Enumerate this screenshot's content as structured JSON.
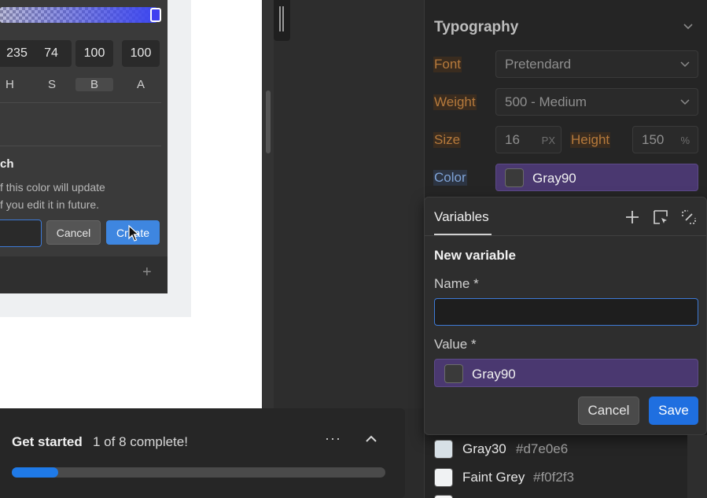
{
  "color_picker": {
    "values": [
      "235",
      "74",
      "100",
      "100"
    ],
    "labels": [
      "H",
      "S",
      "B",
      "A"
    ],
    "swatch_title": "ch",
    "swatch_desc_1": "f this color will update",
    "swatch_desc_2": "f you edit it in future.",
    "cancel_label": "Cancel",
    "create_label": "Create",
    "add_symbol": "+"
  },
  "get_started": {
    "title": "Get started",
    "count": "1 of 8 complete!",
    "more": "···",
    "progress": 0.125
  },
  "typography": {
    "title": "Typography",
    "font_label": "Font",
    "font_value": "Pretendard",
    "weight_label": "Weight",
    "weight_value": "500 - Medium",
    "size_label": "Size",
    "size_value": "16",
    "size_unit": "PX",
    "height_label": "Height",
    "height_value": "150",
    "height_unit": "%",
    "color_label": "Color",
    "color_value": "Gray90"
  },
  "variables": {
    "tab_label": "Variables",
    "new_title": "New variable",
    "name_label": "Name *",
    "name_value": "",
    "value_label": "Value *",
    "value_color": "Gray90",
    "cancel_label": "Cancel",
    "save_label": "Save"
  },
  "swatches": [
    {
      "name": "Gray30",
      "hex": "#d7e0e6"
    },
    {
      "name": "Faint Grey",
      "hex": "#f0f2f3"
    }
  ],
  "colors": {
    "accent": "#1f6fe0",
    "variable_field": "#4a3870",
    "label_orange": "#b67a3c"
  }
}
